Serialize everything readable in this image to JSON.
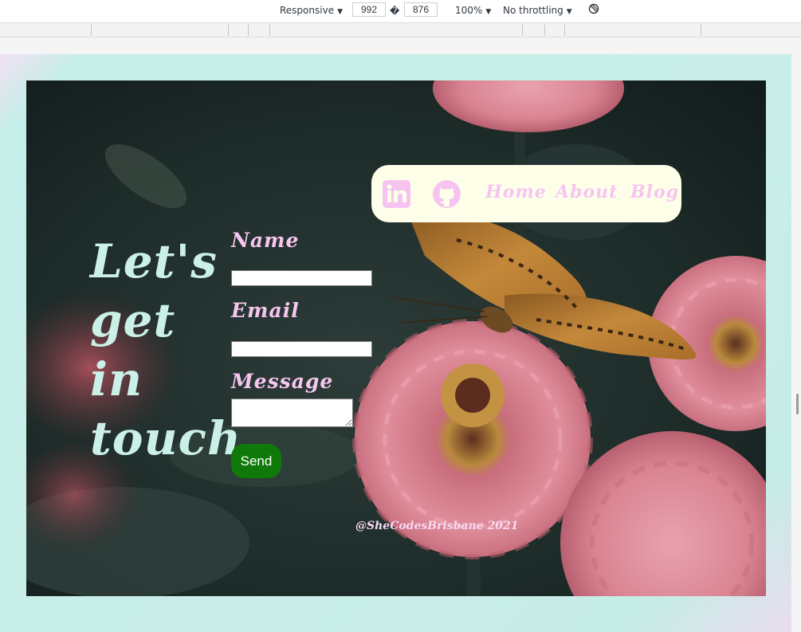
{
  "devtools": {
    "device_mode": "Responsive",
    "width": "992",
    "height": "876",
    "dimension_separator": "�",
    "zoom": "100%",
    "throttling": "No throttling",
    "caret": "▼"
  },
  "hero": {
    "heading_lines": [
      "Let's",
      "get",
      "in",
      "touch"
    ]
  },
  "form": {
    "name_label": "Name",
    "email_label": "Email",
    "message_label": "Message",
    "name_value": "",
    "email_value": "",
    "message_value": "",
    "send_label": "Send"
  },
  "nav": {
    "icons": [
      "linkedin-icon",
      "github-icon"
    ],
    "links": [
      "Home",
      "About",
      "Blog"
    ]
  },
  "footer": {
    "credit": "@SheCodesBrisbane 2021"
  },
  "colors": {
    "heading": "#caf0e8",
    "labels": "#f6c6ee",
    "nav_background": "#fdffe9",
    "nav_links": "#f7c4f2",
    "send_button": "#0f7a0a",
    "page_gradient": "#c6eee8"
  }
}
